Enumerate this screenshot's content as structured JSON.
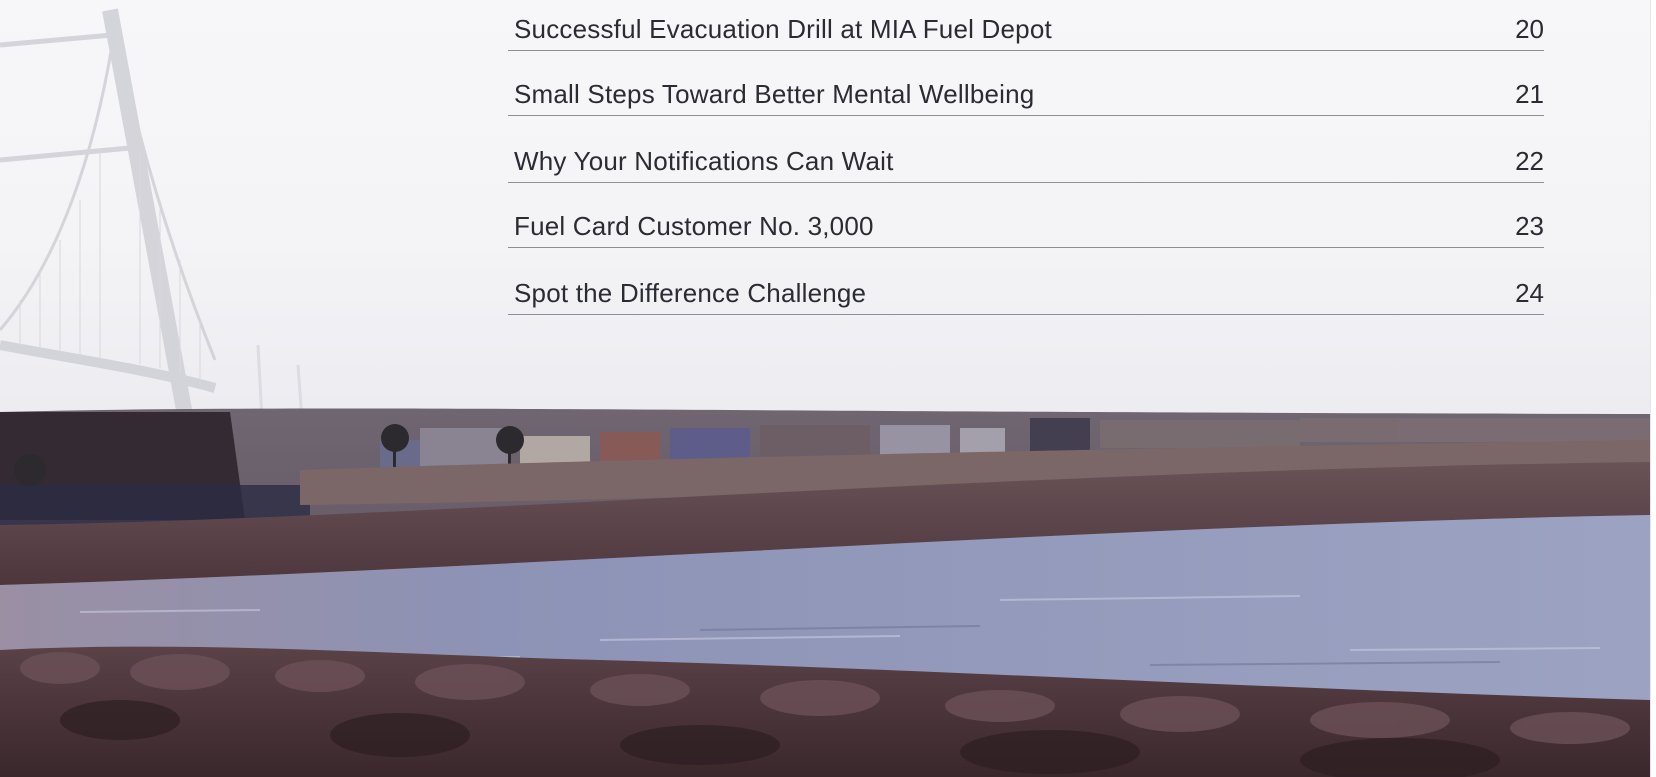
{
  "toc": {
    "entries": [
      {
        "title": "Successful Evacuation Drill at MIA Fuel Depot",
        "page": "20"
      },
      {
        "title": "Small Steps Toward Better Mental Wellbeing",
        "page": "21"
      },
      {
        "title": "Why Your Notifications Can Wait",
        "page": "22"
      },
      {
        "title": "Fuel Card Customer No. 3,000",
        "page": "23"
      },
      {
        "title": "Spot the Difference Challenge",
        "page": "24"
      }
    ]
  },
  "colors": {
    "text": "#2b2b33",
    "rule": "#8e8e96",
    "sky": "#f4f4f6",
    "water": "#8a8fb0",
    "rocks": "#4a3238"
  }
}
